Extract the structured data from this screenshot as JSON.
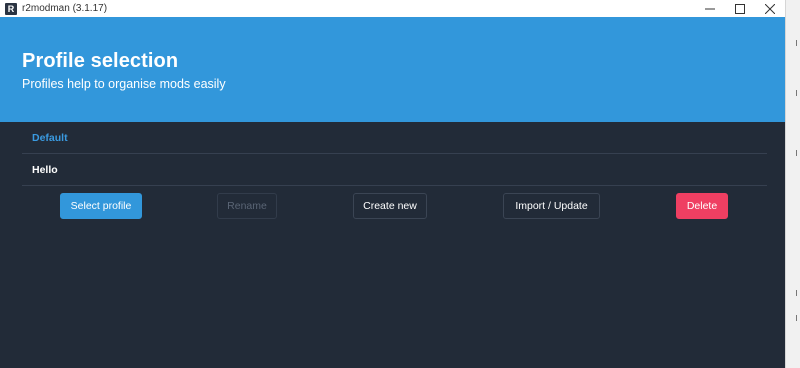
{
  "window": {
    "app_icon_letter": "R",
    "title": "r2modman (3.1.17)",
    "controls": [
      "minimize-icon",
      "maximize-icon",
      "close-icon"
    ]
  },
  "header": {
    "title": "Profile selection",
    "subtitle": "Profiles help to organise mods easily"
  },
  "profiles": [
    {
      "name": "Default",
      "selected": true
    },
    {
      "name": "Hello",
      "selected": false
    }
  ],
  "actions": {
    "select_profile": "Select profile",
    "rename": "Rename",
    "create_new": "Create new",
    "import_update": "Import / Update",
    "delete": "Delete"
  },
  "colors": {
    "accent": "#3297db",
    "background": "#222b38",
    "danger": "#ef3f62",
    "selected_text": "#3a9ae0"
  }
}
